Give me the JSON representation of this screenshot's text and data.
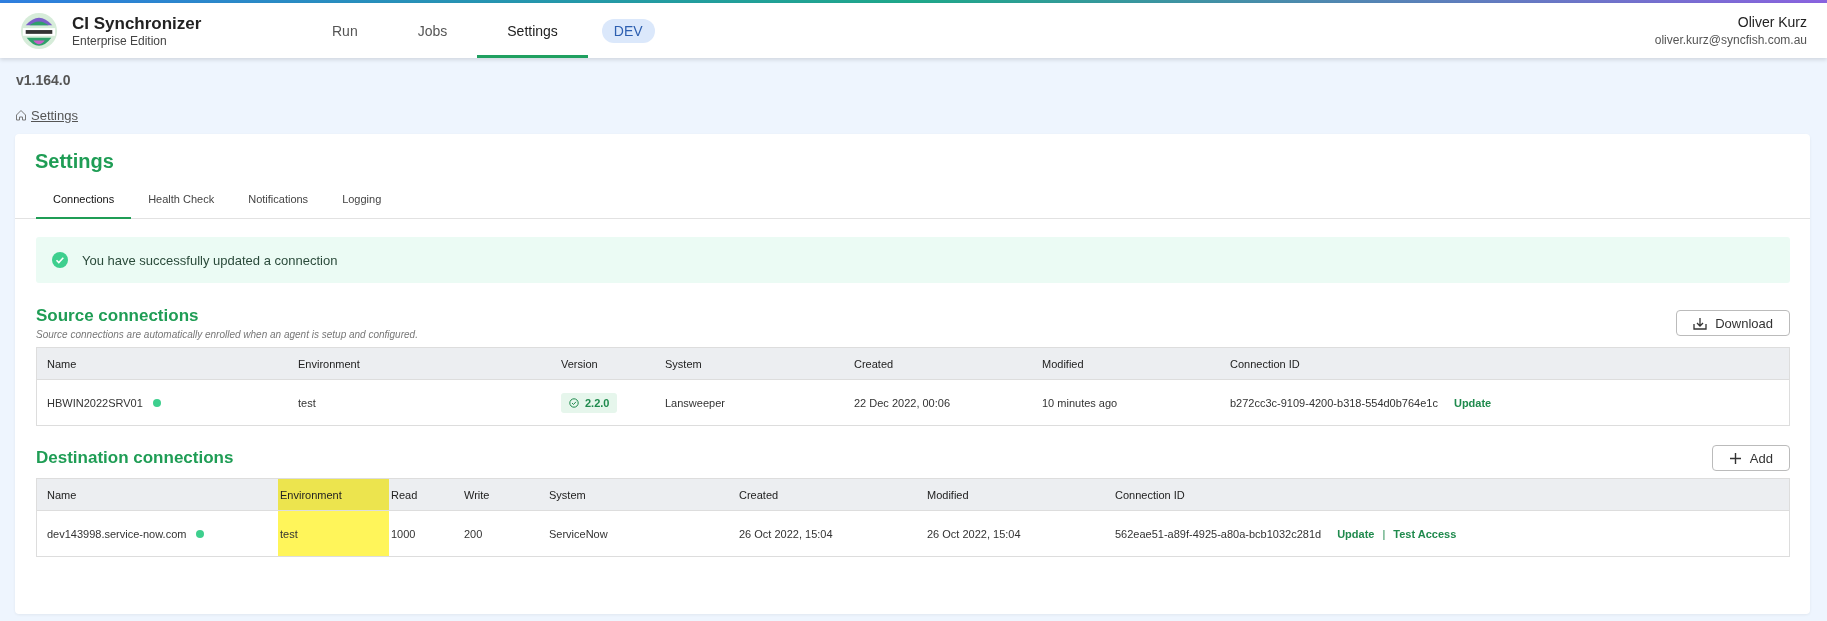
{
  "header": {
    "app_title": "CI Synchronizer",
    "app_subtitle": "Enterprise Edition",
    "nav": [
      {
        "label": "Run",
        "selected": false
      },
      {
        "label": "Jobs",
        "selected": false
      },
      {
        "label": "Settings",
        "selected": true
      }
    ],
    "env_badge": "DEV",
    "user": {
      "name": "Oliver Kurz",
      "email": "oliver.kurz@syncfish.com.au"
    }
  },
  "version": "v1.164.0",
  "breadcrumb": "Settings",
  "settings": {
    "title": "Settings",
    "tabs": [
      {
        "label": "Connections",
        "selected": true
      },
      {
        "label": "Health Check",
        "selected": false
      },
      {
        "label": "Notifications",
        "selected": false
      },
      {
        "label": "Logging",
        "selected": false
      }
    ],
    "alert": {
      "kind": "success",
      "message": "You have successfully updated a connection"
    },
    "source_connections": {
      "title": "Source connections",
      "subtitle": "Source connections are automatically enrolled when an agent is setup and configured.",
      "button": {
        "kind": "download",
        "label": "Download"
      },
      "columns": [
        {
          "label": "Name",
          "highlighted": false
        },
        {
          "label": "Environment",
          "highlighted": false
        },
        {
          "label": "Version",
          "highlighted": false
        },
        {
          "label": "System",
          "highlighted": false
        },
        {
          "label": "Created",
          "highlighted": false
        },
        {
          "label": "Modified",
          "highlighted": false
        },
        {
          "label": "Connection ID",
          "highlighted": false
        }
      ],
      "rows": [
        {
          "color": "#3ecf8e",
          "cells": [
            "HBWIN2022SRV01",
            "test",
            "2.2.0",
            "Lansweeper",
            "22 Dec 2022, 00:06",
            "10 minutes ago",
            "b272cc3c-9109-4200-b318-554d0b764e1c"
          ],
          "actions": [
            "Update"
          ]
        }
      ]
    },
    "destination_connections": {
      "title": "Destination connections",
      "button": {
        "kind": "add",
        "label": "Add"
      },
      "action_separator": "|",
      "columns": [
        {
          "label": "Name",
          "highlighted": false
        },
        {
          "label": "Environment",
          "highlighted": true
        },
        {
          "label": "Read",
          "highlighted": false
        },
        {
          "label": "Write",
          "highlighted": false
        },
        {
          "label": "System",
          "highlighted": false
        },
        {
          "label": "Created",
          "highlighted": false
        },
        {
          "label": "Modified",
          "highlighted": false
        },
        {
          "label": "Connection ID",
          "highlighted": false
        }
      ],
      "rows": [
        {
          "color": "#3ecf8e",
          "cells": [
            "dev143998.service-now.com",
            "test",
            "1000",
            "200",
            "ServiceNow",
            "26 Oct 2022, 15:04",
            "26 Oct 2022, 15:04",
            "562eae51-a89f-4925-a80a-bcb1032c281d"
          ],
          "actions": [
            "Update",
            "Test Access"
          ]
        }
      ]
    }
  }
}
